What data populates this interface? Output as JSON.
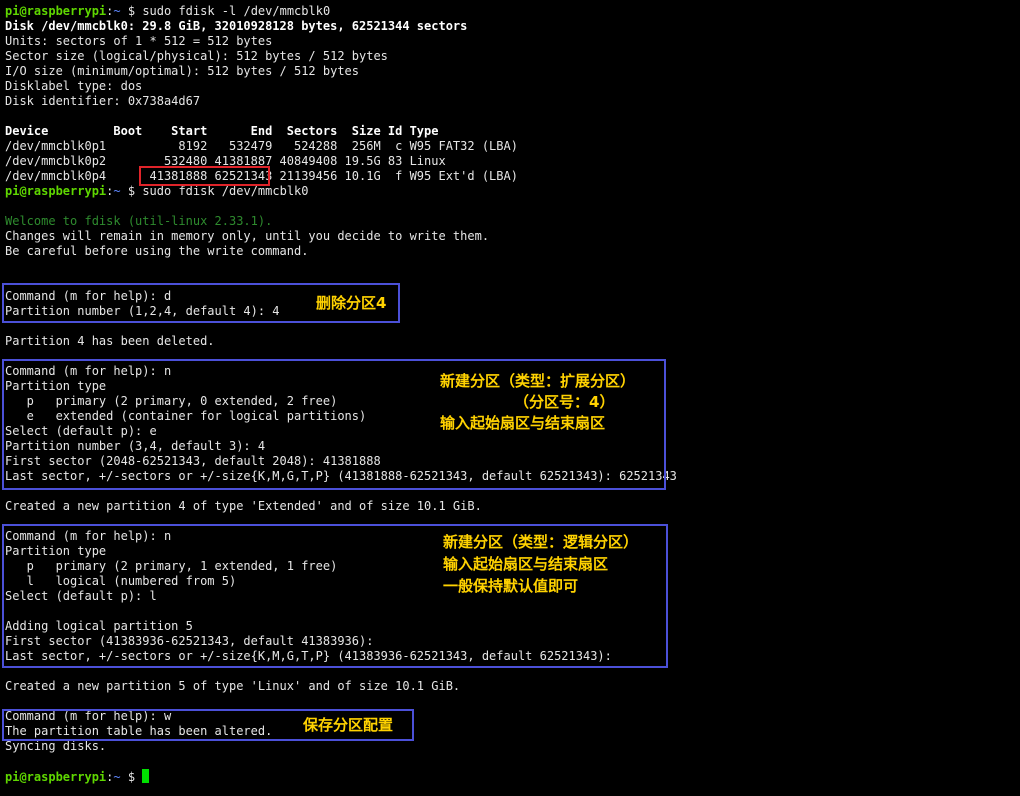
{
  "terminal": {
    "prompt": {
      "user": "pi@raspberrypi",
      "path": "~",
      "symbol": "$"
    },
    "cmd1": "sudo fdisk -l /dev/mmcblk0",
    "disk_line": "Disk /dev/mmcblk0: 29.8 GiB, 32010928128 bytes, 62521344 sectors",
    "info_lines": [
      "Units: sectors of 1 * 512 = 512 bytes",
      "Sector size (logical/physical): 512 bytes / 512 bytes",
      "I/O size (minimum/optimal): 512 bytes / 512 bytes",
      "Disklabel type: dos",
      "Disk identifier: 0x738a4d67"
    ],
    "table_header": "Device         Boot    Start      End  Sectors  Size Id Type",
    "table_rows": [
      "/dev/mmcblk0p1          8192   532479   524288  256M  c W95 FAT32 (LBA)",
      "/dev/mmcblk0p2        532480 41381887 40849408 19.5G 83 Linux",
      "/dev/mmcblk0p4      41381888 62521343 21139456 10.1G  f W95 Ext'd (LBA)"
    ],
    "cmd2": "sudo fdisk /dev/mmcblk0",
    "welcome": "Welcome to fdisk (util-linux 2.33.1).",
    "warn_lines": [
      "Changes will remain in memory only, until you decide to write them.",
      "Be careful before using the write command."
    ],
    "block1": [
      "Command (m for help): d",
      "Partition number (1,2,4, default 4): 4"
    ],
    "deleted": "Partition 4 has been deleted.",
    "block2": [
      "Command (m for help): n",
      "Partition type",
      "   p   primary (2 primary, 0 extended, 2 free)",
      "   e   extended (container for logical partitions)",
      "Select (default p): e",
      "Partition number (3,4, default 3): 4",
      "First sector (2048-62521343, default 2048): 41381888",
      "Last sector, +/-sectors or +/-size{K,M,G,T,P} (41381888-62521343, default 62521343): 62521343"
    ],
    "created_ext": "Created a new partition 4 of type 'Extended' and of size 10.1 GiB.",
    "block3": [
      "Command (m for help): n",
      "Partition type",
      "   p   primary (2 primary, 1 extended, 1 free)",
      "   l   logical (numbered from 5)",
      "Select (default p): l",
      "",
      "Adding logical partition 5",
      "First sector (41383936-62521343, default 41383936):",
      "Last sector, +/-sectors or +/-size{K,M,G,T,P} (41383936-62521343, default 62521343):"
    ],
    "created_linux": "Created a new partition 5 of type 'Linux' and of size 10.1 GiB.",
    "block4": [
      "Command (m for help): w",
      "The partition table has been altered."
    ],
    "syncing": "Syncing disks."
  },
  "annotations": {
    "delete": "删除分区4",
    "extended": [
      "新建分区（类型：扩展分区）",
      "（分区号：4）",
      "输入起始扇区与结束扇区"
    ],
    "logical": [
      "新建分区（类型：逻辑分区）",
      "输入起始扇区与结束扇区",
      "一般保持默认值即可"
    ],
    "save": "保存分区配置"
  },
  "colors": {
    "box": "#4b50d8",
    "highlight": "#e0242a",
    "note": "#ffd200",
    "prompt_user": "#5fd700",
    "prompt_path": "#5f87ff"
  }
}
